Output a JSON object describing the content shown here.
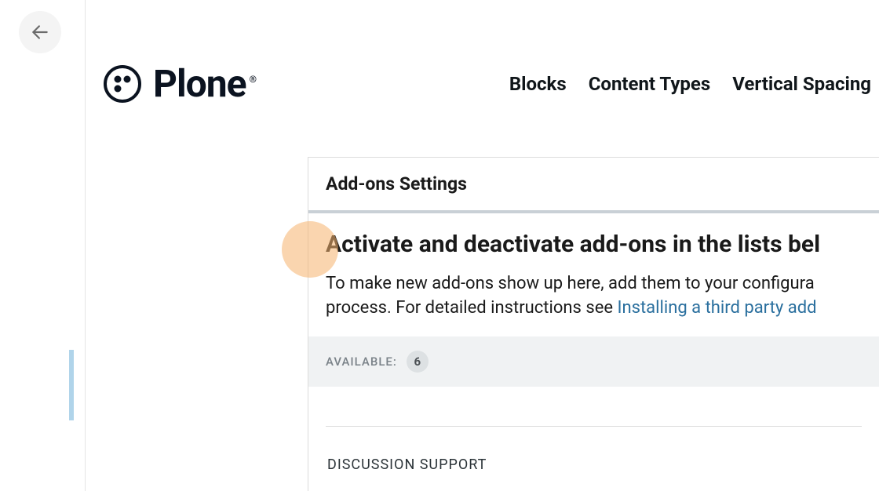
{
  "header": {
    "brand_name": "Plone",
    "brand_reg": "®",
    "nav": [
      "Blocks",
      "Content Types",
      "Vertical Spacing"
    ]
  },
  "panel": {
    "title": "Add-ons Settings",
    "section_heading": "Activate and deactivate add-ons in the lists bel",
    "description_part1": "To make new add-ons show up here, add them to your configura",
    "description_part2": "process. For detailed instructions see ",
    "description_link": "Installing a third party add",
    "available_label": "AVAILABLE:",
    "available_count": "6",
    "addon_items": [
      "DISCUSSION SUPPORT"
    ]
  }
}
